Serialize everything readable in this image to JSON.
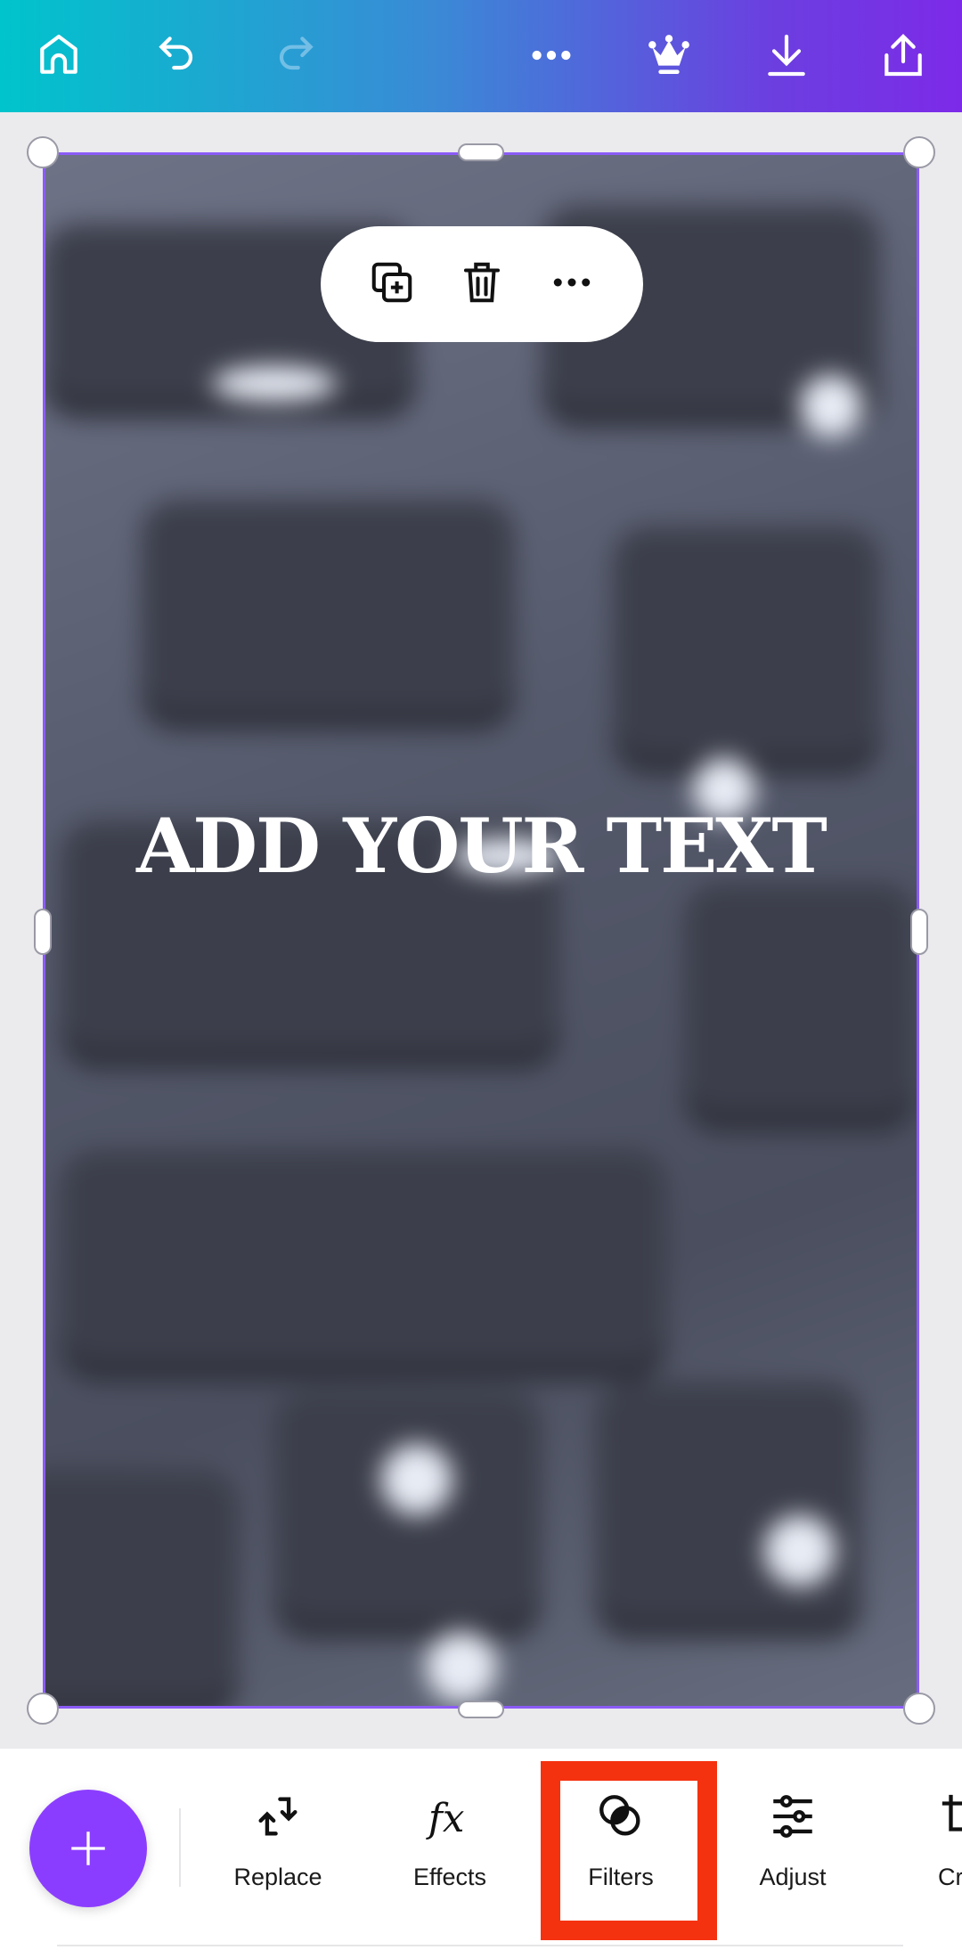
{
  "topbar": {
    "icons": [
      "home-icon",
      "undo-icon",
      "redo-icon",
      "more-icon",
      "crown-icon",
      "download-icon",
      "share-icon"
    ],
    "gradient": [
      "#00c4cc",
      "#7d2ae8"
    ]
  },
  "canvas": {
    "text": "ADD YOUR TEXT",
    "selection_color": "#8b5cf6"
  },
  "context_menu": {
    "icons": [
      "duplicate-icon",
      "delete-icon",
      "more-icon"
    ]
  },
  "toolbar": {
    "add_button_color": "#8b3dff",
    "items": [
      {
        "label": "Replace",
        "icon": "replace-icon"
      },
      {
        "label": "Effects",
        "icon": "fx-icon"
      },
      {
        "label": "Filters",
        "icon": "filters-icon"
      },
      {
        "label": "Adjust",
        "icon": "adjust-icon"
      },
      {
        "label": "Cr",
        "icon": "crop-icon"
      }
    ],
    "highlight_color": "#f5320f"
  }
}
